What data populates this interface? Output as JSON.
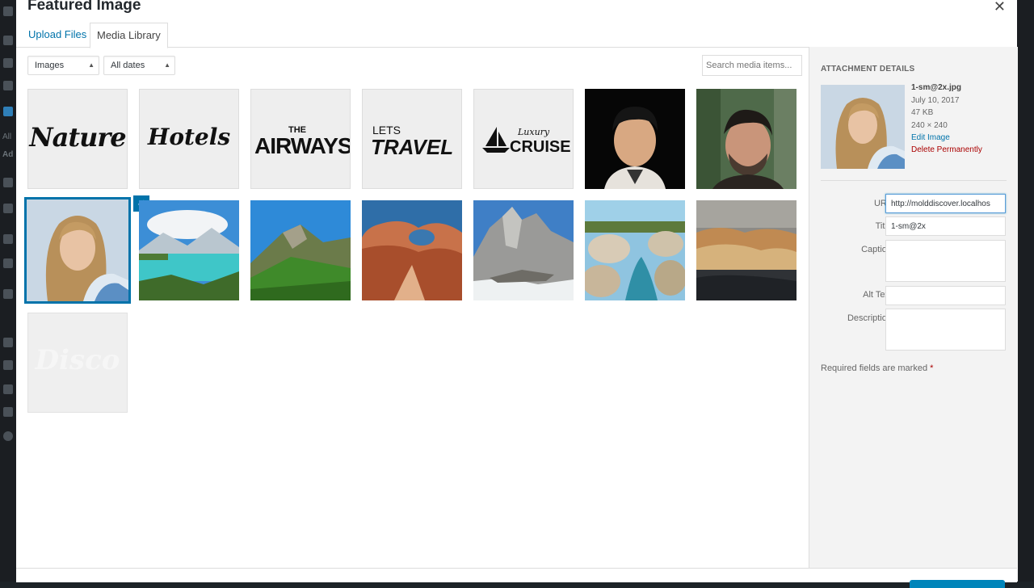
{
  "modal": {
    "title": "Featured Image",
    "tabs": [
      {
        "label": "Upload Files"
      },
      {
        "label": "Media Library"
      }
    ]
  },
  "toolbar": {
    "type_filter": "Images",
    "date_filter": "All dates",
    "search_placeholder": "Search media items..."
  },
  "media_items": [
    {
      "kind": "logo",
      "text": "Nature"
    },
    {
      "kind": "logo",
      "text": "Hotels"
    },
    {
      "kind": "logo",
      "text_small": "THE",
      "text": "AIRWAYS"
    },
    {
      "kind": "logo",
      "text_small": "LETS",
      "text": "TRAVEL"
    },
    {
      "kind": "logo",
      "text_small": "Luxury",
      "text": "CRUISE"
    },
    {
      "kind": "photo",
      "subject": "man portrait"
    },
    {
      "kind": "photo",
      "subject": "bearded man portrait"
    },
    {
      "kind": "photo",
      "subject": "woman portrait",
      "selected": true
    },
    {
      "kind": "photo",
      "subject": "lake and mountains"
    },
    {
      "kind": "photo",
      "subject": "green mountain"
    },
    {
      "kind": "photo",
      "subject": "red rock arch"
    },
    {
      "kind": "photo",
      "subject": "grey peaks"
    },
    {
      "kind": "photo",
      "subject": "river rocks"
    },
    {
      "kind": "photo",
      "subject": "rocky shore"
    },
    {
      "kind": "logo",
      "text": "Disco"
    }
  ],
  "details": {
    "heading": "ATTACHMENT DETAILS",
    "filename": "1-sm@2x.jpg",
    "date": "July 10, 2017",
    "size": "47 KB",
    "dimensions": "240 × 240",
    "edit_link": "Edit Image",
    "delete_link": "Delete Permanently",
    "fields": {
      "url_label": "URL",
      "url_value": "http://molddiscover.localhos",
      "title_label": "Title",
      "title_value": "1-sm@2x",
      "caption_label": "Caption",
      "caption_value": "",
      "alt_label": "Alt Text",
      "alt_value": "",
      "description_label": "Description",
      "description_value": ""
    },
    "required_note": "Required fields are marked",
    "required_star": "*"
  },
  "admin_sidebar": {
    "labels": [
      "All",
      "Ad"
    ]
  },
  "colors": {
    "accent": "#0073aa",
    "danger": "#a00000",
    "admin_bg": "#1d2327"
  },
  "icons": {
    "close": "close-icon",
    "checkmark": "checkmark-icon",
    "select_arrow": "chevron-updown-icon"
  }
}
